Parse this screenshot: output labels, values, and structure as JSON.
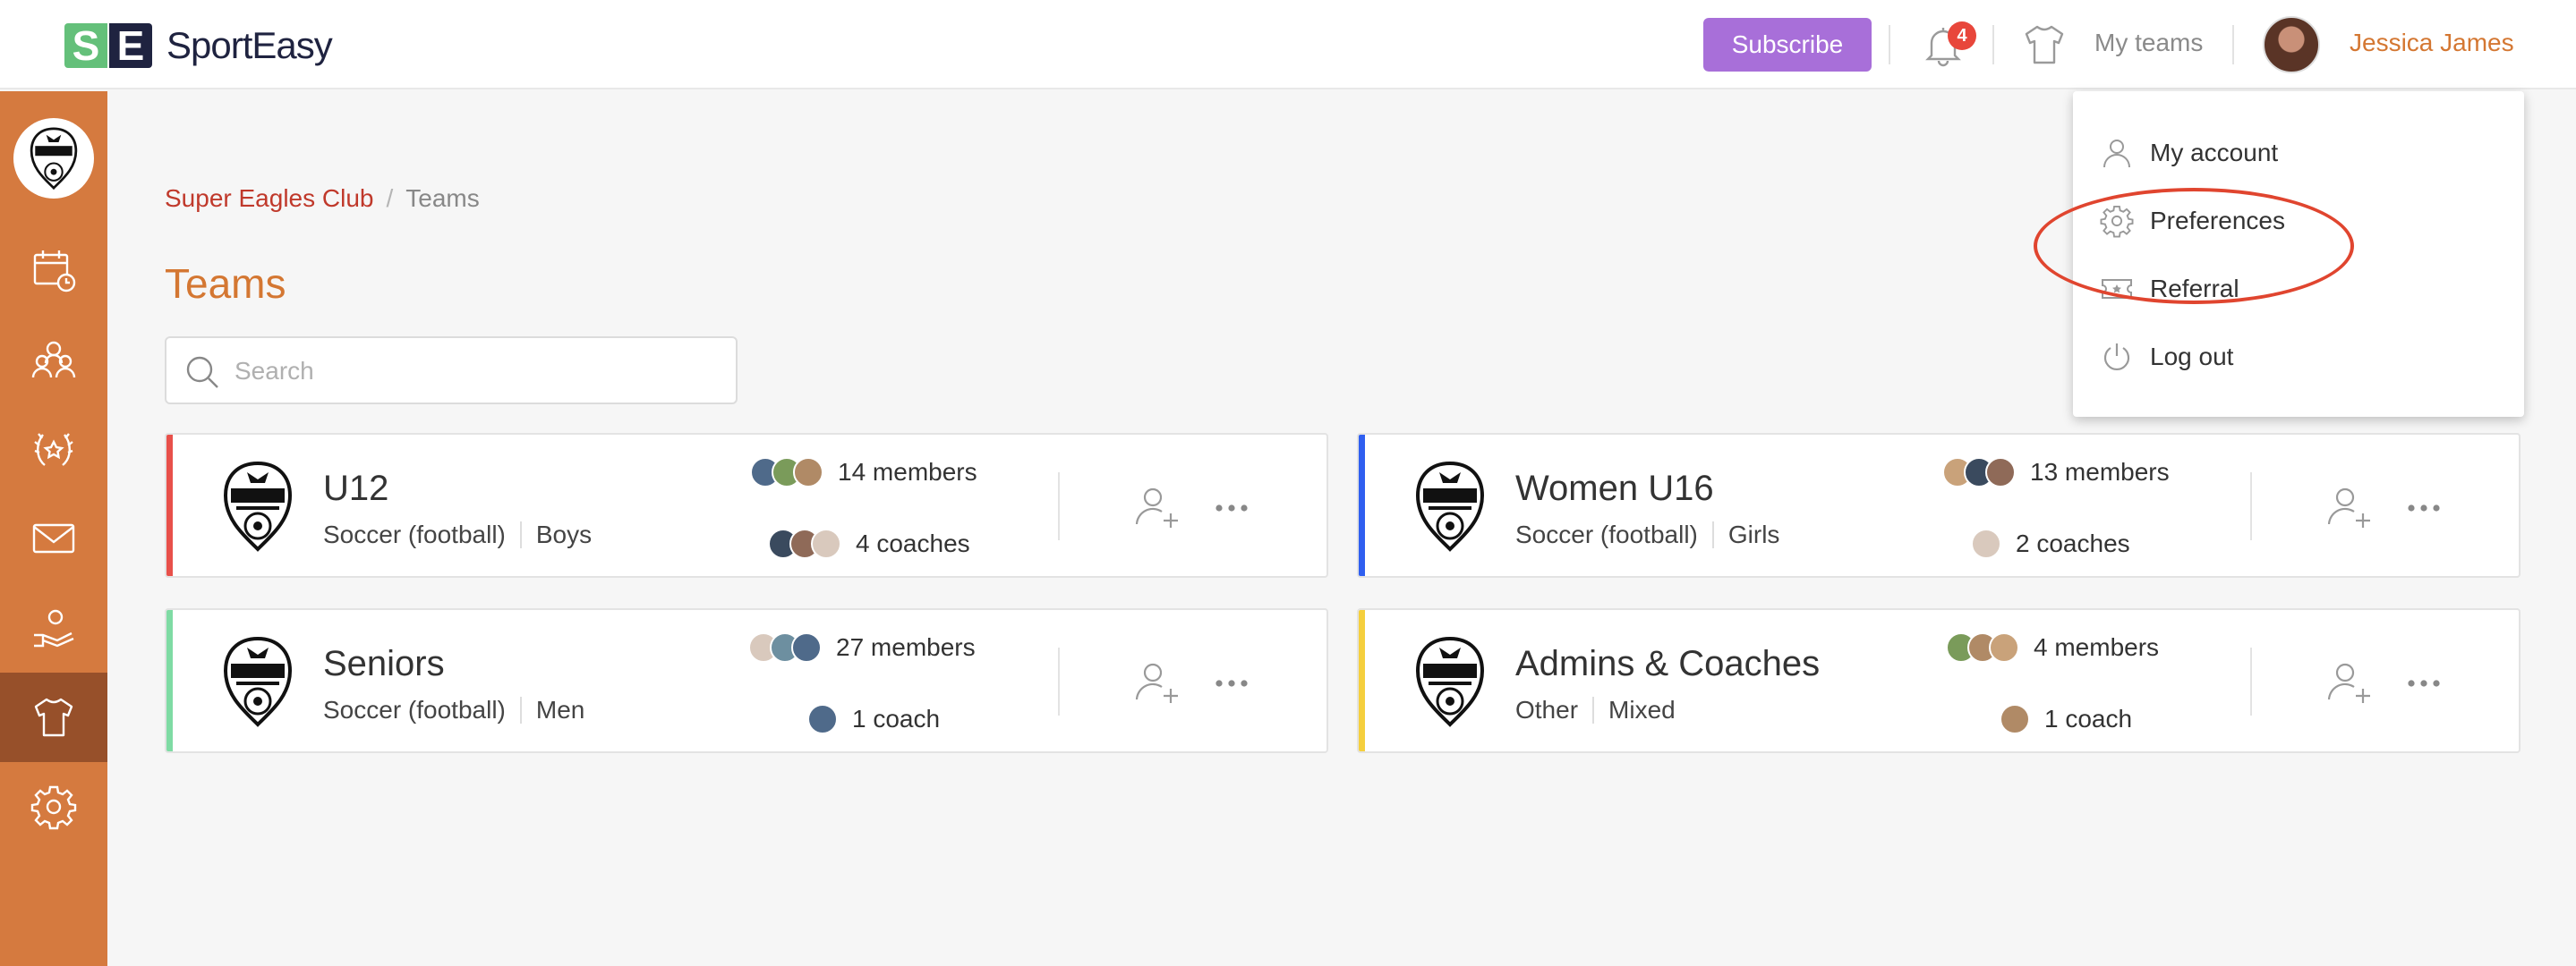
{
  "header": {
    "logo_text": "SportEasy",
    "logo_letters": [
      "S",
      "E"
    ],
    "subscribe_label": "Subscribe",
    "notification_count": "4",
    "my_teams_label": "My teams",
    "user_name": "Jessica James"
  },
  "colors": {
    "accent_orange": "#d57a3f",
    "subscribe_purple": "#a86fd9",
    "badge_red": "#e8463b",
    "link_red": "#c0392b"
  },
  "sidebar": {
    "items": [
      {
        "name": "calendar-icon"
      },
      {
        "name": "people-icon"
      },
      {
        "name": "laurel-icon"
      },
      {
        "name": "mail-icon"
      },
      {
        "name": "hand-heart-icon"
      },
      {
        "name": "shirt-icon",
        "active": true
      },
      {
        "name": "gear-icon"
      }
    ]
  },
  "breadcrumb": {
    "club": "Super Eagles Club",
    "separator": "/",
    "current": "Teams"
  },
  "page": {
    "title": "Teams",
    "search_placeholder": "Search"
  },
  "teams": [
    {
      "name": "U12",
      "sport": "Soccer (football)",
      "gender": "Boys",
      "members": "14 members",
      "coaches": "4 coaches",
      "stripe": "#e8504a"
    },
    {
      "name": "Women U16",
      "sport": "Soccer (football)",
      "gender": "Girls",
      "members": "13 members",
      "coaches": "2 coaches",
      "stripe": "#2f5ff0"
    },
    {
      "name": "Seniors",
      "sport": "Soccer (football)",
      "gender": "Men",
      "members": "27 members",
      "coaches": "1 coach",
      "stripe": "#7fdba4"
    },
    {
      "name": "Admins & Coaches",
      "sport": "Other",
      "gender": "Mixed",
      "members": "4 members",
      "coaches": "1 coach",
      "stripe": "#f5cf3d"
    }
  ],
  "dropdown": {
    "items": [
      {
        "label": "My account",
        "icon": "user-icon"
      },
      {
        "label": "Preferences",
        "icon": "gear-icon"
      },
      {
        "label": "Referral",
        "icon": "ticket-icon"
      },
      {
        "label": "Log out",
        "icon": "power-icon"
      }
    ]
  }
}
